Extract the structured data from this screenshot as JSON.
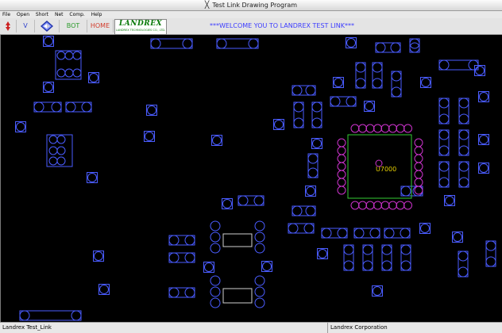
{
  "window": {
    "title": "Test Link Drawing Program"
  },
  "menu": [
    "File",
    "Open",
    "Short",
    "Net",
    "Comp.",
    "Help"
  ],
  "toolbar": {
    "v_label": "V",
    "bot_label": "BOT",
    "home_label": "HOME",
    "logo_brand": "LANDREX",
    "logo_sub": "LANDREX TECHNOLOGIES CO., LTD.",
    "welcome": "***WELCOME YOU TO LANDREX TEST LINK***"
  },
  "canvas": {
    "component_label": "U7000"
  },
  "colors": {
    "pad": "#4a5cff",
    "ic_pad": "#cc33cc",
    "ic_outline": "#33cc33",
    "label": "#e8d000"
  },
  "status": {
    "left": "Landrex Test_Link",
    "right": "Landrex Corporation"
  }
}
